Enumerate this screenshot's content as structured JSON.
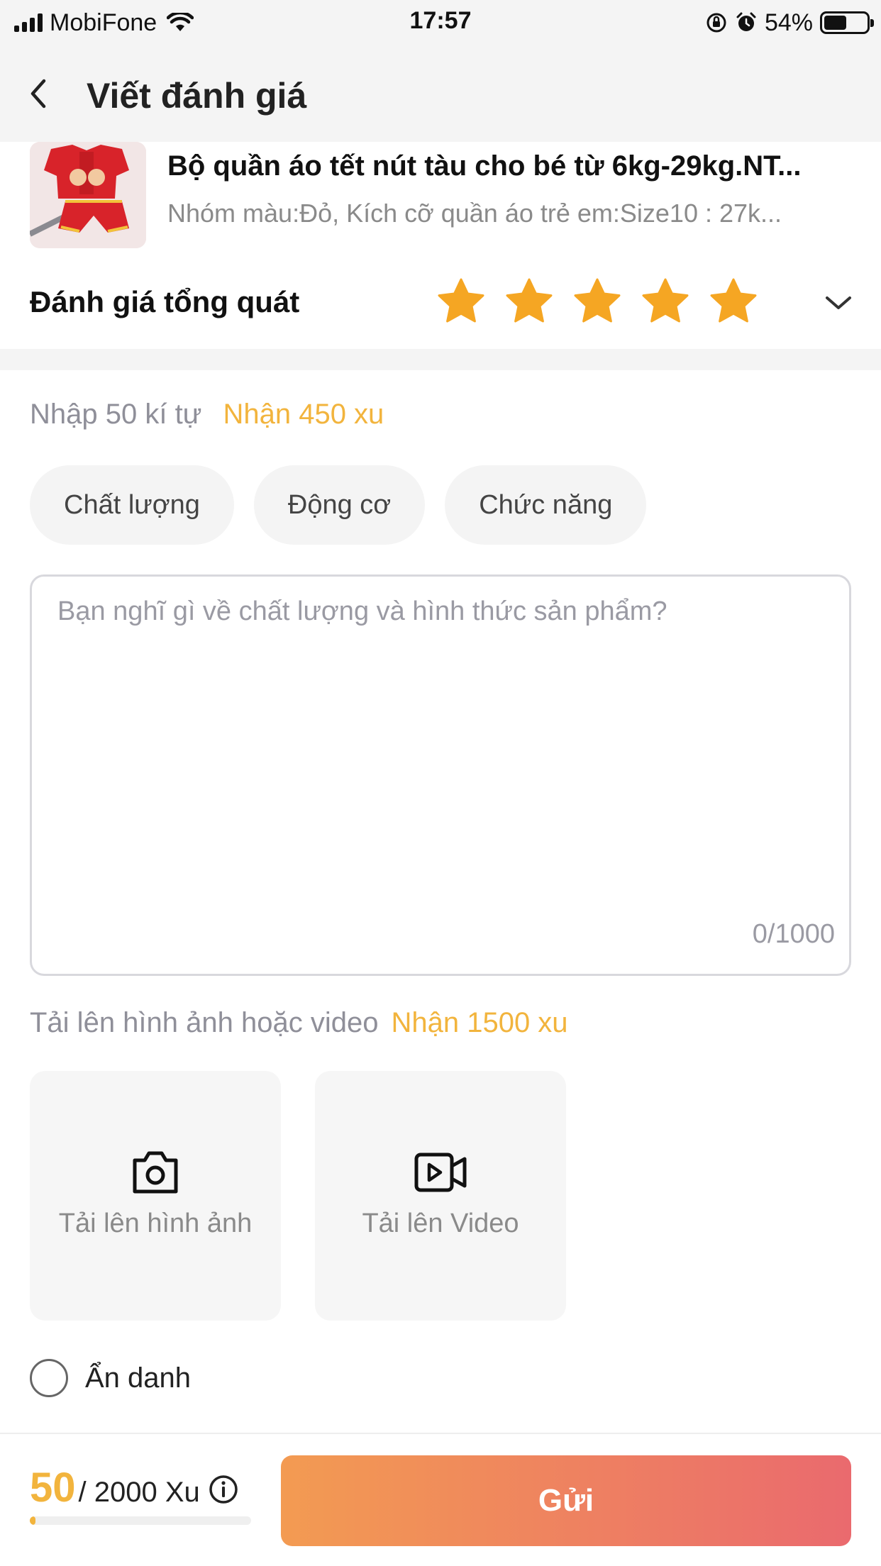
{
  "status_bar": {
    "carrier": "MobiFone",
    "time": "17:57",
    "battery": "54%",
    "battery_level": 0.54
  },
  "nav": {
    "title": "Viết đánh giá",
    "back_icon": "chevron-left-icon"
  },
  "product": {
    "title": "Bộ quần áo tết nút tàu cho bé từ 6kg-29kg.NT...",
    "variant": "Nhóm màu:Đỏ, Kích cỡ quần áo trẻ em:Size10 : 27k..."
  },
  "rating": {
    "label": "Đánh giá tổng quát",
    "stars": 5,
    "max_stars": 5,
    "star_color": "#f5a623"
  },
  "review": {
    "hint": "Nhập 50 kí tự",
    "reward": "Nhận 450 xu",
    "tags": [
      "Chất lượng",
      "Động cơ",
      "Chức năng"
    ],
    "placeholder": "Bạn nghĩ gì về chất lượng và hình thức sản phẩm?",
    "counter": "0/1000"
  },
  "upload": {
    "hint": "Tải lên hình ảnh hoặc video",
    "reward": "Nhận 1500 xu",
    "photo_label": "Tải lên hình ảnh",
    "video_label": "Tải lên Video"
  },
  "anonymous": {
    "label": "Ẩn danh",
    "checked": false
  },
  "footer": {
    "xu_current": "50",
    "xu_total": "/ 2000 Xu",
    "xu_progress": 0.025,
    "submit_label": "Gửi"
  },
  "colors": {
    "accent": "#f2b43d",
    "button_start": "#f39b52",
    "button_end": "#ea6a6e"
  }
}
